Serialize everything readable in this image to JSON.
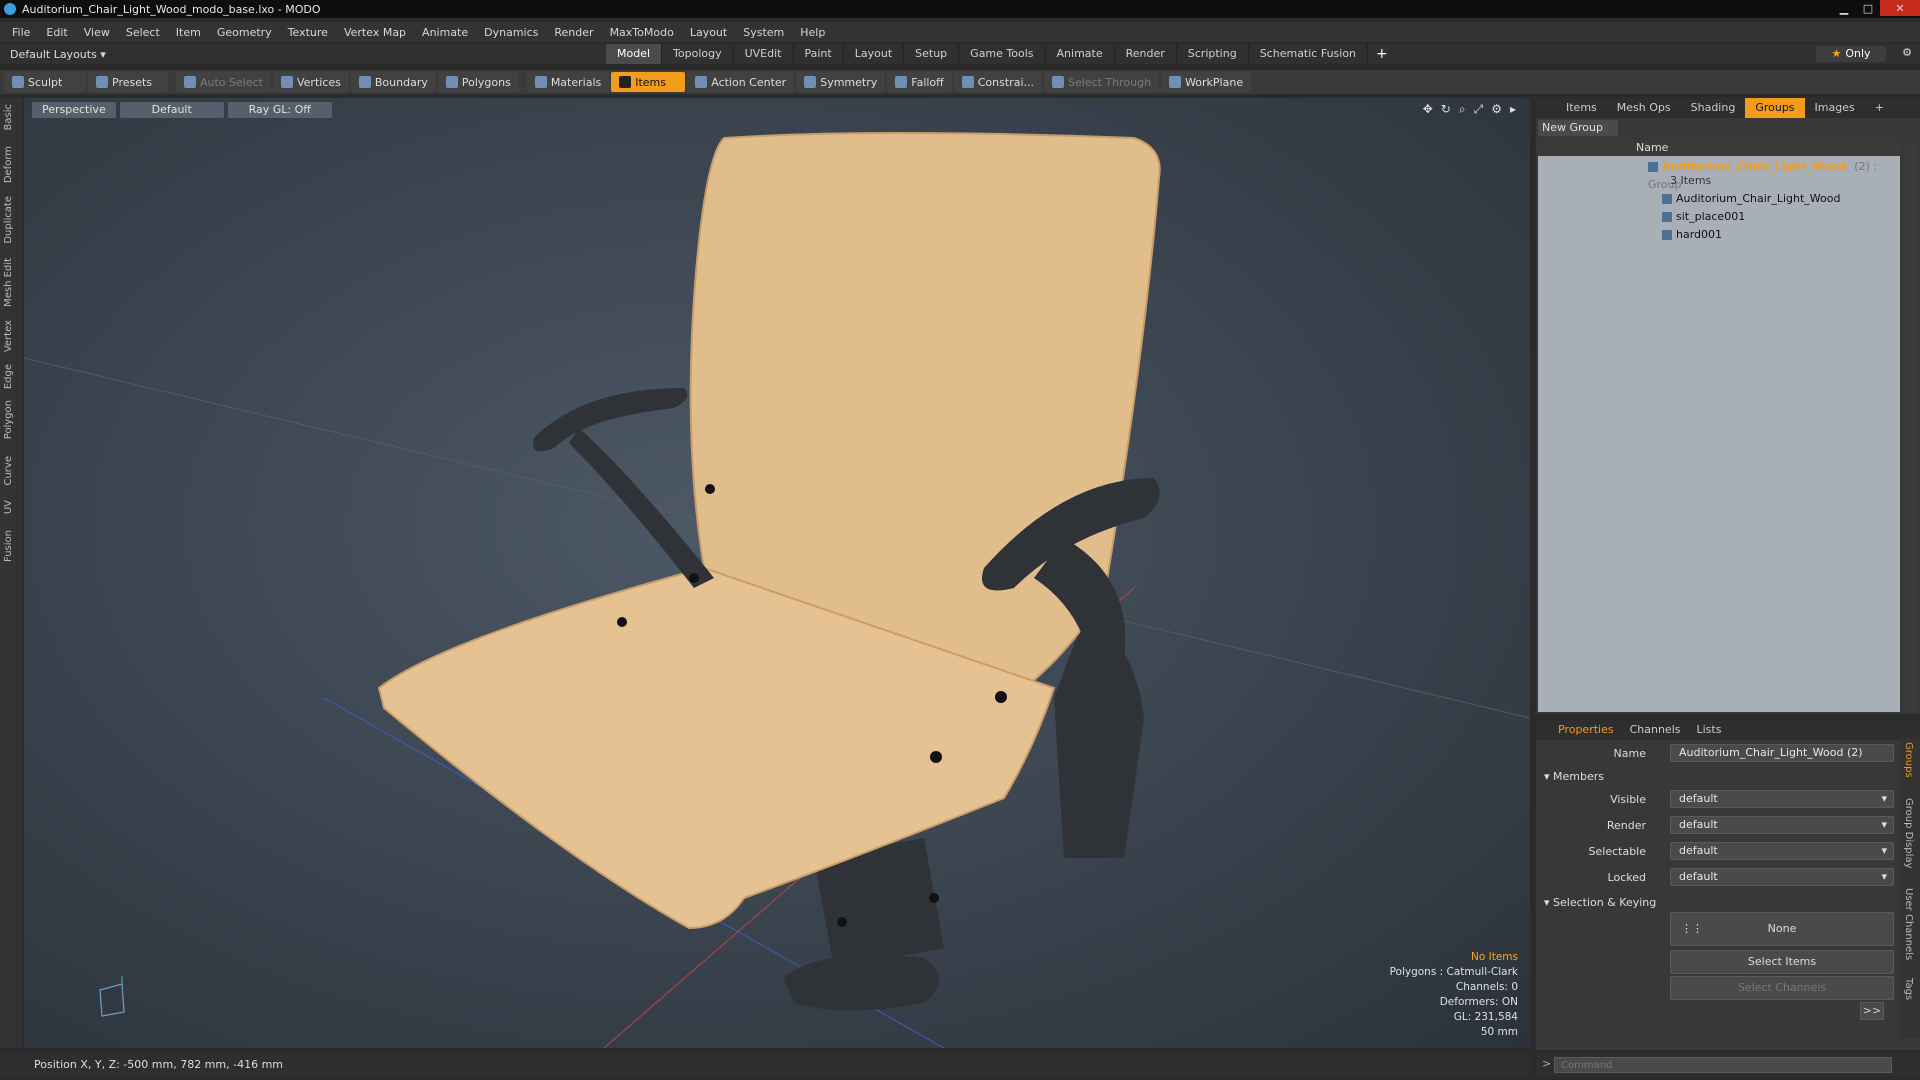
{
  "window": {
    "title": "Auditorium_Chair_Light_Wood_modo_base.lxo - MODO"
  },
  "menu": [
    "File",
    "Edit",
    "View",
    "Select",
    "Item",
    "Geometry",
    "Texture",
    "Vertex Map",
    "Animate",
    "Dynamics",
    "Render",
    "MaxToModo",
    "Layout",
    "System",
    "Help"
  ],
  "layout": {
    "layouts_label": "Default Layouts ▾",
    "tabs": [
      "Model",
      "Topology",
      "UVEdit",
      "Paint",
      "Layout",
      "Setup",
      "Game Tools",
      "Animate",
      "Render",
      "Scripting",
      "Schematic Fusion"
    ],
    "active_tab": "Model",
    "only_label": "Only"
  },
  "toolbar": {
    "sculpt": "Sculpt",
    "presets": "Presets",
    "auto_select": "Auto Select",
    "vertices": "Vertices",
    "boundary": "Boundary",
    "polygons": "Polygons",
    "materials": "Materials",
    "items": "Items",
    "action_center": "Action Center",
    "symmetry": "Symmetry",
    "falloff": "Falloff",
    "constraints": "Constrai...",
    "select_through": "Select Through",
    "workplane": "WorkPlane"
  },
  "left_tabs": [
    "Basic",
    "Deform",
    "Duplicate",
    "Mesh Edit",
    "Vertex",
    "Edge",
    "Polygon",
    "Curve",
    "UV",
    "Fusion"
  ],
  "viewport": {
    "view": "Perspective",
    "shading": "Default",
    "raygl": "Ray GL: Off",
    "info": {
      "no_items": "No Items",
      "polygons": "Polygons : Catmull-Clark",
      "channels": "Channels: 0",
      "deformers": "Deformers: ON",
      "gl": "GL: 231,584",
      "scale": "50 mm"
    }
  },
  "status": {
    "position": "Position X, Y, Z:  -500 mm, 782 mm, -416 mm"
  },
  "command": {
    "placeholder": "Command"
  },
  "items_panel": {
    "tabs": [
      "Items",
      "Mesh Ops",
      "Shading",
      "Groups",
      "Images"
    ],
    "active_tab": "Groups",
    "new_group": "New Group",
    "name_header": "Name",
    "group_name": "Auditorium_Chair_Light_Wood",
    "group_suffix": "(2) : Group",
    "items_count": "3 Items",
    "children": [
      "Auditorium_Chair_Light_Wood",
      "sit_place001",
      "hard001"
    ]
  },
  "properties": {
    "tabs": [
      "Properties",
      "Channels",
      "Lists"
    ],
    "name_label": "Name",
    "name_value": "Auditorium_Chair_Light_Wood (2)",
    "members": "Members",
    "visible_label": "Visible",
    "visible_value": "default",
    "render_label": "Render",
    "render_value": "default",
    "selectable_label": "Selectable",
    "selectable_value": "default",
    "locked_label": "Locked",
    "locked_value": "default",
    "selection_keying": "Selection & Keying",
    "none": "None",
    "select_items": "Select Items",
    "select_channels": "Select Channels",
    "more": ">>"
  },
  "side_tabs": [
    "Groups",
    "Group Display",
    "User Channels",
    "Tags"
  ],
  "colors": {
    "accent": "#f39c1c",
    "wood": "#e2bd8c",
    "plastic": "#2f3236"
  }
}
